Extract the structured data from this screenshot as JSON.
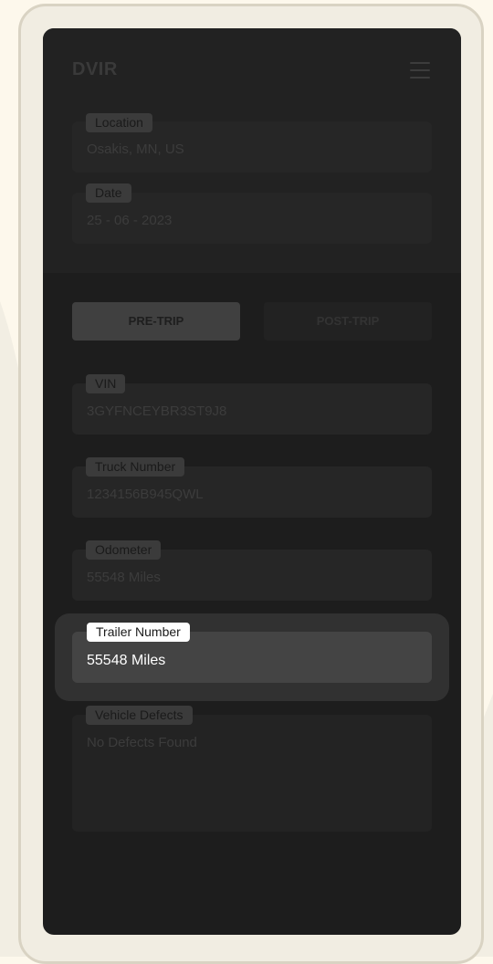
{
  "app": {
    "title": "DVIR"
  },
  "header_fields": [
    {
      "label": "Location",
      "value": "Osakis, MN, US"
    },
    {
      "label": "Date",
      "value": "25 - 06 - 2023"
    }
  ],
  "tabs": {
    "pre_trip": "PRE-TRIP",
    "post_trip": "POST-TRIP"
  },
  "fields": {
    "vin": {
      "label": "VIN",
      "value": "3GYFNCEYBR3ST9J8"
    },
    "truck_number": {
      "label": "Truck Number",
      "value": "1234156B945QWL"
    },
    "odometer": {
      "label": "Odometer",
      "value": "55548 Miles"
    },
    "trailer_number": {
      "label": "Trailer Number",
      "value": "55548 Miles"
    },
    "vehicle_defects": {
      "label": "Vehicle Defects",
      "value": "No Defects Found"
    }
  },
  "colors": {
    "page_bg": "#fdf8ec",
    "screen_bg": "#1d1d1d",
    "highlight_card": "#313131",
    "highlight_field": "#444444"
  }
}
